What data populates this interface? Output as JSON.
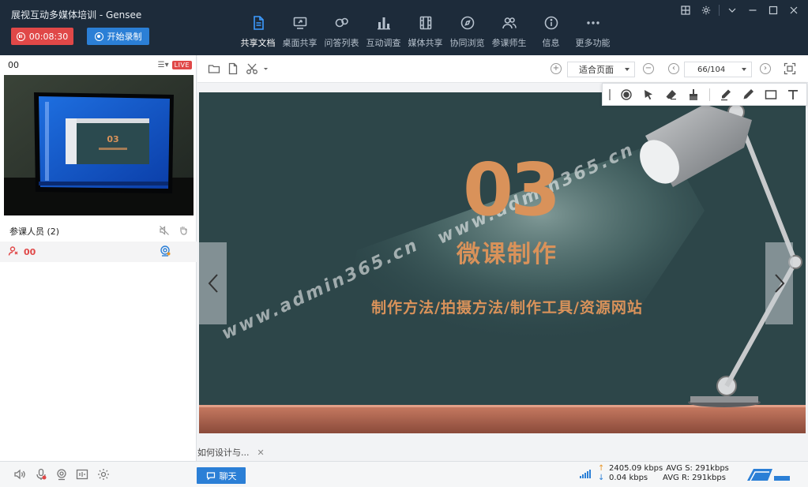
{
  "window": {
    "title": "展视互动多媒体培训  - Gensee"
  },
  "header": {
    "timer_label": "00:08:30",
    "record_label": "开始录制",
    "nav": [
      {
        "label": "共享文档",
        "icon": "document-icon",
        "active": true
      },
      {
        "label": "桌面共享",
        "icon": "desktop-share-icon",
        "active": false
      },
      {
        "label": "问答列表",
        "icon": "qa-icon",
        "active": false
      },
      {
        "label": "互动调查",
        "icon": "poll-icon",
        "active": false
      },
      {
        "label": "媒体共享",
        "icon": "media-icon",
        "active": false
      },
      {
        "label": "协同浏览",
        "icon": "compass-icon",
        "active": false
      },
      {
        "label": "参课师生",
        "icon": "users-icon",
        "active": false
      },
      {
        "label": "信息",
        "icon": "info-icon",
        "active": false
      },
      {
        "label": "更多功能",
        "icon": "more-icon",
        "active": false
      }
    ]
  },
  "left_panel": {
    "video_owner": "00",
    "live_label": "LIVE",
    "attendees_label": "参课人员 (2)",
    "attendees": [
      {
        "name": "00"
      }
    ]
  },
  "doc_toolbar": {
    "fit_mode": "适合页面",
    "page_indicator": "66/104"
  },
  "slide": {
    "number": "03",
    "title": "微课制作",
    "subtitle": "制作方法/拍摄方法/制作工具/资源网站",
    "watermark_1": "www.admin365.cn",
    "watermark_2": "www.admin365.cn"
  },
  "doc_tabs": [
    {
      "label": "如何设计与..."
    }
  ],
  "bottom": {
    "chat_label": "聊天",
    "stats": {
      "upload": "2405.09 kbps",
      "upload_avg": "AVG S: 291kbps",
      "download": "0.04 kbps",
      "download_avg": "AVG R: 291kbps"
    }
  },
  "colors": {
    "header_bg": "#1d2b3a",
    "accent": "#2b7fd6",
    "danger": "#e04848",
    "slide_text": "#d9925a"
  }
}
